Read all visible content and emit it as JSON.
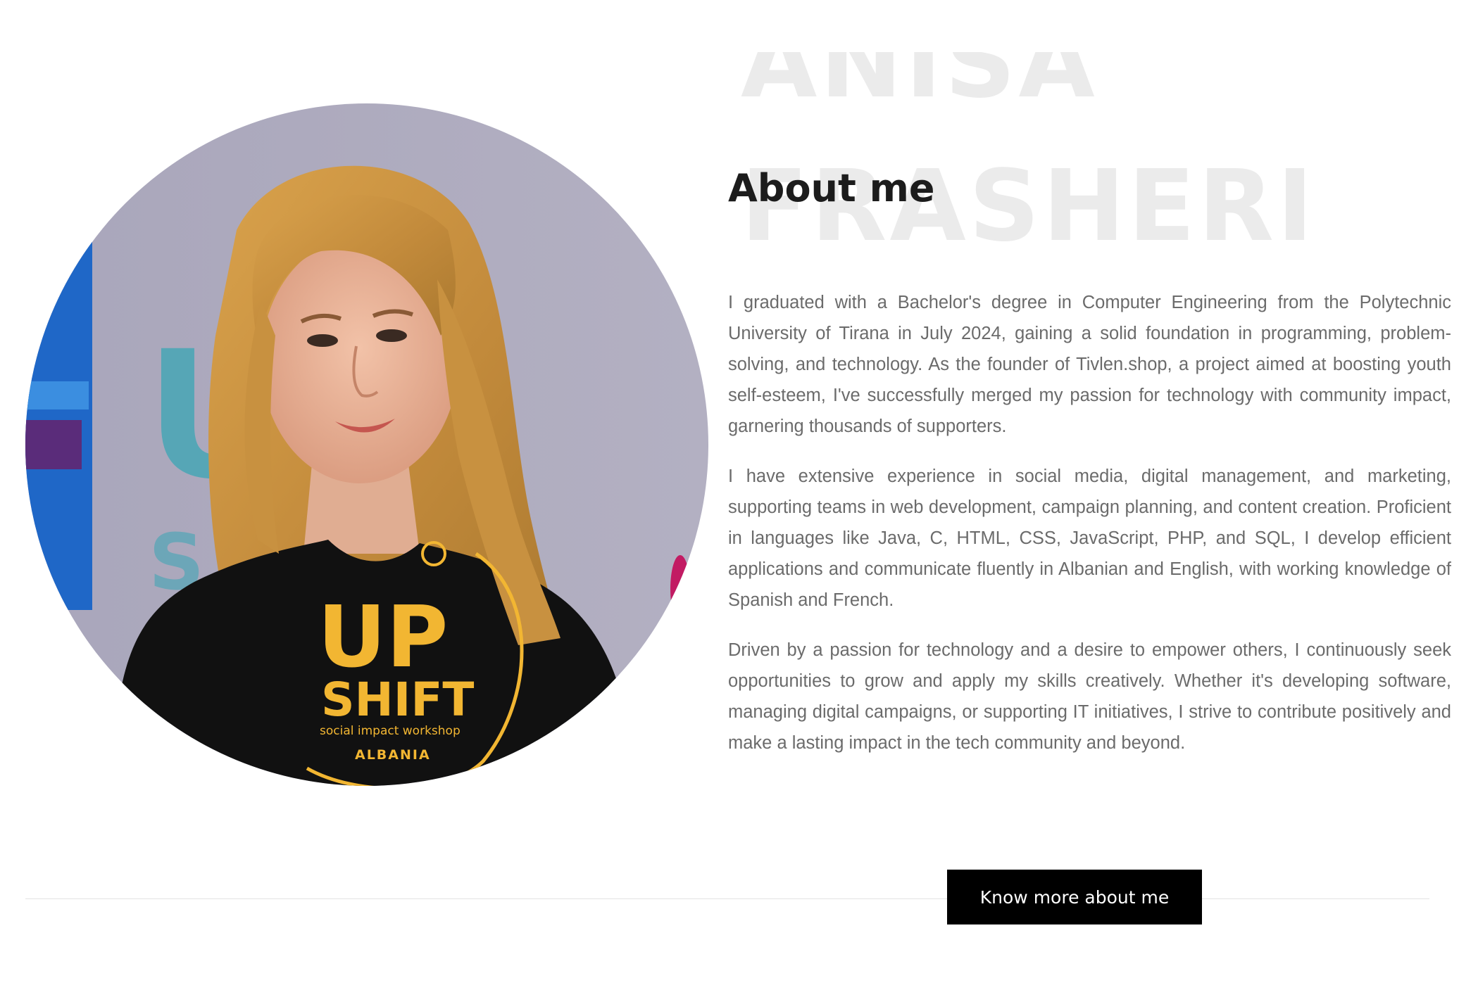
{
  "profile": {
    "first_name": "ANISA",
    "last_name": "FRASHERI",
    "photo_alt": "Portrait of Anisa Frasheri"
  },
  "shirt": {
    "logo_line1": "UP",
    "logo_line2": "SHIFT",
    "tagline": "social impact workshop",
    "country": "ALBANIA"
  },
  "about": {
    "heading": "About me",
    "paragraphs": [
      "I graduated with a Bachelor's degree in Computer Engineering from the Polytechnic University of Tirana in July 2024, gaining a solid foundation in programming, problem-solving, and technology. As the founder of Tivlen.shop, a project aimed at boosting youth self-esteem, I've successfully merged my passion for technology with community impact, garnering thousands of supporters.",
      "I have extensive experience in social media, digital management, and marketing, supporting teams in web development, campaign planning, and content creation. Proficient in languages like Java, C, HTML, CSS, JavaScript, PHP, and SQL, I develop efficient applications and communicate fluently in Albanian and English, with working knowledge of Spanish and French.",
      "Driven by a passion for technology and a desire to empower others, I continuously seek opportunities to grow and apply my skills creatively. Whether it's developing software, managing digital campaigns, or supporting IT initiatives, I strive to contribute positively and make a lasting impact in the tech community and beyond."
    ]
  },
  "cta": {
    "label": "Know more about me"
  },
  "colors": {
    "heading": "#1c1c1c",
    "body_text": "#6b6b6b",
    "watermark": "#ebebeb",
    "button_bg": "#000000",
    "button_text": "#ffffff",
    "shirt_print": "#f2b632"
  }
}
